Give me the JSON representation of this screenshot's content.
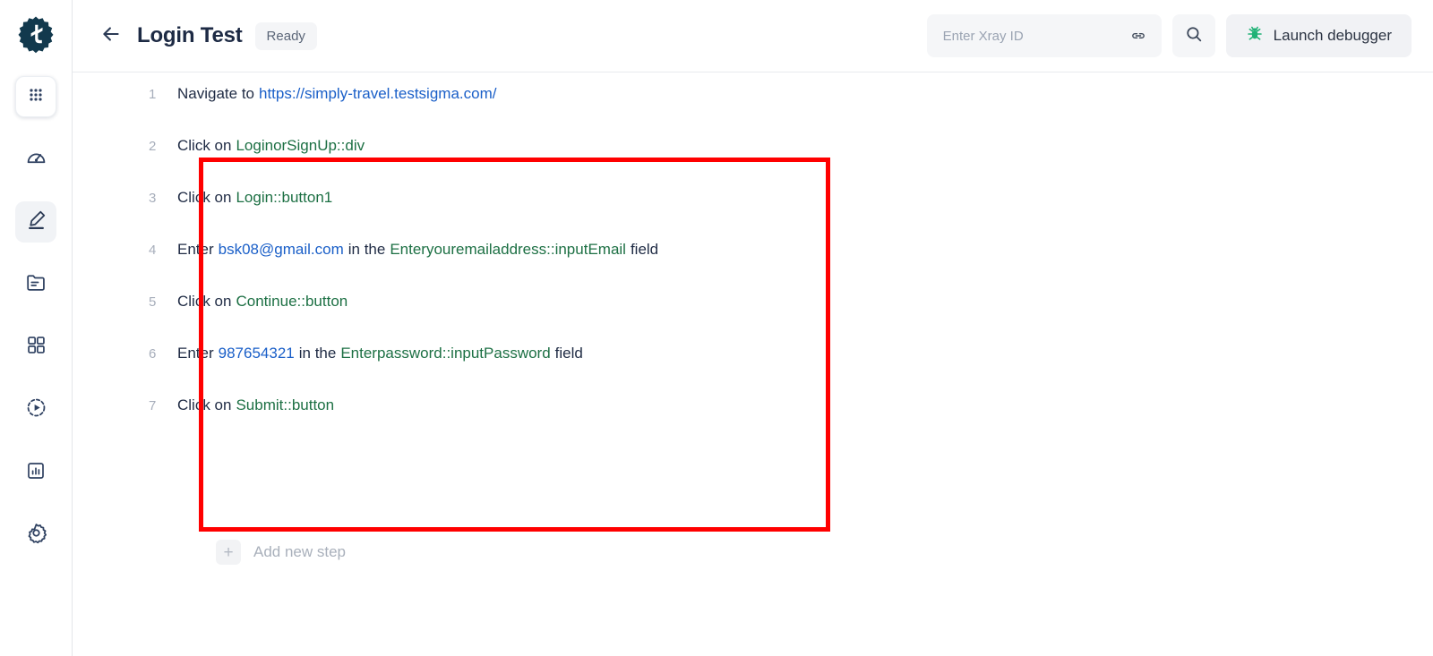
{
  "app": {
    "logo_icon": "testsigma-gear-logo",
    "brand_color": "#12394d"
  },
  "sidebar": {
    "items": [
      {
        "id": "apps",
        "icon": "grid-dots-icon",
        "label": "Apps",
        "state": "boxed"
      },
      {
        "id": "dashboard",
        "icon": "speedometer-icon",
        "label": "Dashboard",
        "state": "normal"
      },
      {
        "id": "create-tests",
        "icon": "pencil-icon",
        "label": "Create Tests",
        "state": "active"
      },
      {
        "id": "test-data",
        "icon": "folder-lines-icon",
        "label": "Test Data",
        "state": "normal"
      },
      {
        "id": "test-suites",
        "icon": "four-squares-icon",
        "label": "Test Suites",
        "state": "normal"
      },
      {
        "id": "run-plans",
        "icon": "play-dashed-circle-icon",
        "label": "Run Plans",
        "state": "normal"
      },
      {
        "id": "reports",
        "icon": "bar-chart-box-icon",
        "label": "Reports",
        "state": "normal"
      },
      {
        "id": "settings",
        "icon": "gear-icon",
        "label": "Settings",
        "state": "normal"
      }
    ]
  },
  "header": {
    "back_icon": "arrow-left-icon",
    "title": "Login Test",
    "status": "Ready",
    "xray": {
      "placeholder": "Enter Xray ID",
      "value": "",
      "icon": "link-icon"
    },
    "search_icon": "search-icon",
    "debugger": {
      "label": "Launch debugger",
      "icon": "bug-icon",
      "icon_color": "#20b276"
    }
  },
  "steps": [
    {
      "number": "1",
      "tokens": [
        {
          "text": "Navigate to",
          "type": "kw"
        },
        {
          "text": "https://simply-travel.testsigma.com/",
          "type": "val"
        }
      ]
    },
    {
      "number": "2",
      "tokens": [
        {
          "text": "Click on",
          "type": "kw"
        },
        {
          "text": "LoginorSignUp::div",
          "type": "el"
        }
      ]
    },
    {
      "number": "3",
      "tokens": [
        {
          "text": "Click on",
          "type": "kw"
        },
        {
          "text": "Login::button1",
          "type": "el"
        }
      ]
    },
    {
      "number": "4",
      "tokens": [
        {
          "text": "Enter",
          "type": "kw"
        },
        {
          "text": "bsk08@gmail.com",
          "type": "val"
        },
        {
          "text": "in the",
          "type": "kw"
        },
        {
          "text": "Enteryouremailaddress::inputEmail",
          "type": "el"
        },
        {
          "text": "field",
          "type": "kw"
        }
      ]
    },
    {
      "number": "5",
      "tokens": [
        {
          "text": "Click on",
          "type": "kw"
        },
        {
          "text": "Continue::button",
          "type": "el"
        }
      ]
    },
    {
      "number": "6",
      "tokens": [
        {
          "text": "Enter",
          "type": "kw"
        },
        {
          "text": "987654321",
          "type": "val"
        },
        {
          "text": "in the",
          "type": "kw"
        },
        {
          "text": "Enterpassword::inputPassword",
          "type": "el"
        },
        {
          "text": "field",
          "type": "kw"
        }
      ]
    },
    {
      "number": "7",
      "tokens": [
        {
          "text": "Click on",
          "type": "kw"
        },
        {
          "text": "Submit::button",
          "type": "el"
        }
      ]
    }
  ],
  "add_step": {
    "icon": "plus-icon",
    "plus": "+",
    "label": "Add new step"
  },
  "annotation": {
    "type": "red-rectangle-highlight",
    "color": "#ff0000"
  },
  "colors": {
    "keyword": "#1f2b44",
    "value": "#1a5fc8",
    "element": "#1d7044",
    "step_number": "#a7aebb"
  }
}
